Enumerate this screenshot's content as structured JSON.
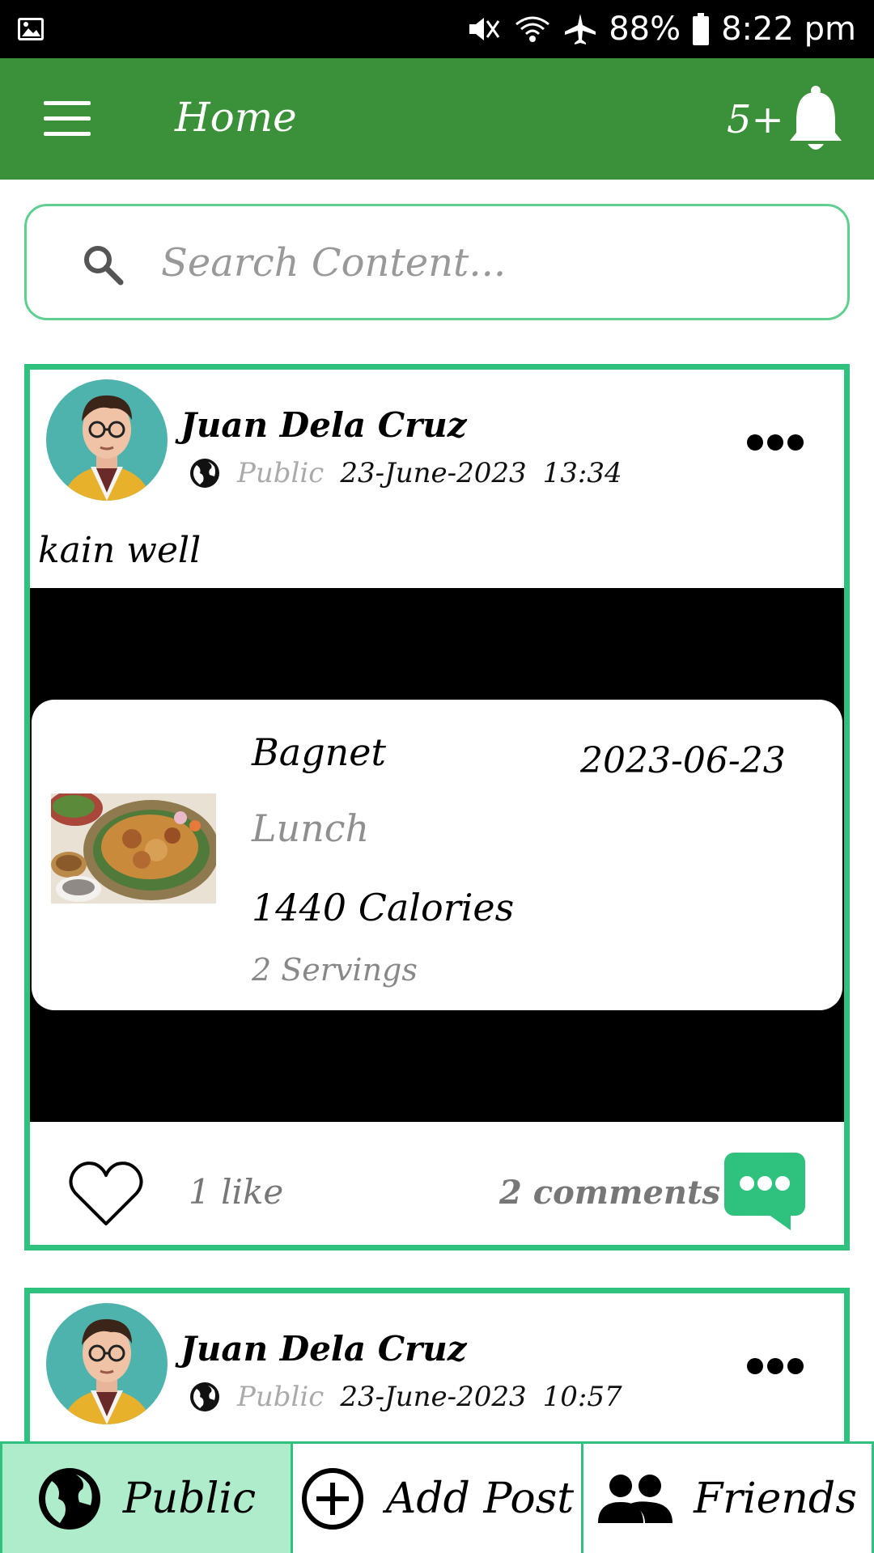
{
  "status_bar": {
    "battery": "88%",
    "time": "8:22 pm"
  },
  "app_bar": {
    "title": "Home",
    "notification_count": "5+"
  },
  "search": {
    "placeholder": "Search Content..."
  },
  "posts": [
    {
      "author": "Juan Dela Cruz",
      "privacy": "Public",
      "date": "23-June-2023",
      "time": "13:34",
      "text": "kain well",
      "meal": {
        "name": "Bagnet",
        "date": "2023-06-23",
        "type": "Lunch",
        "calories": "1440 Calories",
        "servings": "2 Servings"
      },
      "likes": "1 like",
      "comments": "2 comments"
    },
    {
      "author": "Juan Dela Cruz",
      "privacy": "Public",
      "date": "23-June-2023",
      "time": "10:57"
    }
  ],
  "bottom_nav": {
    "items": [
      {
        "label": "Public",
        "icon": "globe-icon",
        "active": true
      },
      {
        "label": "Add Post",
        "icon": "add-circle-icon",
        "active": false
      },
      {
        "label": "Friends",
        "icon": "people-icon",
        "active": false
      }
    ]
  },
  "colors": {
    "primary_green": "#3a9139",
    "accent_green": "#2ec27e",
    "active_tab": "#aeeccb"
  }
}
